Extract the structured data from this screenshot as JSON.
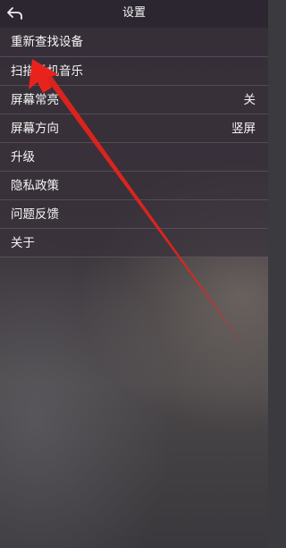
{
  "header": {
    "title": "设置",
    "back_icon": "back-arrow-icon"
  },
  "menu": {
    "items": [
      {
        "label": "重新查找设备",
        "value": ""
      },
      {
        "label": "扫描手机音乐",
        "value": ""
      },
      {
        "label": "屏幕常亮",
        "value": "关"
      },
      {
        "label": "屏幕方向",
        "value": "竖屏"
      },
      {
        "label": "升级",
        "value": ""
      },
      {
        "label": "隐私政策",
        "value": ""
      },
      {
        "label": "问题反馈",
        "value": ""
      },
      {
        "label": "关于",
        "value": ""
      }
    ]
  },
  "colors": {
    "annotation_arrow": "#e8231c",
    "header_bg": "#2b2630"
  }
}
